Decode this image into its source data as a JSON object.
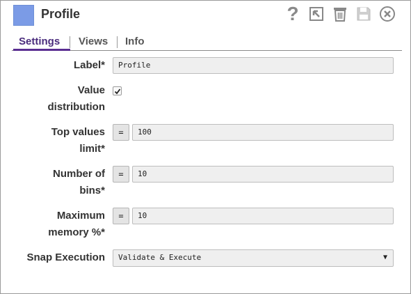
{
  "header": {
    "title": "Profile",
    "swatch_color": "#7b9be6",
    "icons": [
      "help-icon",
      "export-icon",
      "delete-icon",
      "save-icon",
      "close-icon"
    ],
    "help_glyph": "?"
  },
  "tabs": [
    {
      "label": "Settings",
      "active": true
    },
    {
      "label": "Views",
      "active": false
    },
    {
      "label": "Info",
      "active": false
    }
  ],
  "form": {
    "label": {
      "label": "Label*",
      "value": "Profile"
    },
    "value_distribution": {
      "label_line1": "Value",
      "label_line2": "distribution",
      "checked": true
    },
    "top_values_limit": {
      "label_line1": "Top values",
      "label_line2": "limit*",
      "value": "100",
      "expr_glyph": "="
    },
    "number_of_bins": {
      "label_line1": "Number of",
      "label_line2": "bins*",
      "value": "10",
      "expr_glyph": "="
    },
    "maximum_memory": {
      "label_line1": "Maximum",
      "label_line2": "memory %*",
      "value": "10",
      "expr_glyph": "="
    },
    "snap_execution": {
      "label": "Snap Execution",
      "value": "Validate & Execute",
      "arrow": "▼"
    }
  },
  "colors": {
    "accent": "#5a2d91",
    "field_bg": "#efefef"
  }
}
